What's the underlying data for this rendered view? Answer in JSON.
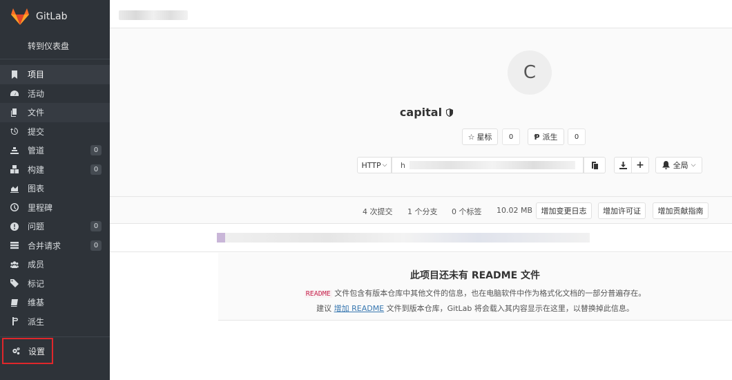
{
  "brand": {
    "name": "GitLab"
  },
  "sidebar": {
    "dashboard_link": "转到仪表盘",
    "items": [
      {
        "label": "项目",
        "icon": "bookmark-icon",
        "count": null
      },
      {
        "label": "活动",
        "icon": "dashboard-icon",
        "count": null
      },
      {
        "label": "文件",
        "icon": "files-icon",
        "count": null
      },
      {
        "label": "提交",
        "icon": "history-icon",
        "count": null
      },
      {
        "label": "管道",
        "icon": "pipeline-icon",
        "count": "0"
      },
      {
        "label": "构建",
        "icon": "cubes-icon",
        "count": "0"
      },
      {
        "label": "图表",
        "icon": "area-chart-icon",
        "count": null
      },
      {
        "label": "里程碑",
        "icon": "clock-icon",
        "count": null
      },
      {
        "label": "问题",
        "icon": "exclamation-circle-icon",
        "count": "0"
      },
      {
        "label": "合并请求",
        "icon": "tasks-icon",
        "count": "0"
      },
      {
        "label": "成员",
        "icon": "users-icon",
        "count": null
      },
      {
        "label": "标记",
        "icon": "tags-icon",
        "count": null
      },
      {
        "label": "维基",
        "icon": "book-icon",
        "count": null
      },
      {
        "label": "派生",
        "icon": "fork-icon",
        "count": null
      }
    ],
    "settings": "设置"
  },
  "project": {
    "avatar_letter": "C",
    "name": "capital",
    "star_label": "星标",
    "star_count": "0",
    "fork_label": "派生",
    "fork_count": "0",
    "protocol": "HTTP",
    "url_prefix": "h",
    "global_label": "全局"
  },
  "stats": {
    "commits": "4 次提交",
    "branches": "1 个分支",
    "tags": "0 个标签",
    "size": "10.02 MB",
    "add_changelog": "增加变更日志",
    "add_license": "增加许可证",
    "add_contributing": "增加贡献指南"
  },
  "readme": {
    "title": "此项目还未有 README 文件",
    "code": "README",
    "line1_rest": " 文件包含有版本仓库中其他文件的信息，也在电脑软件中作为格式化文档的一部分普遍存在。",
    "line2_pre": "建议 ",
    "line2_link": "增加 README",
    "line2_post": " 文件到版本仓库，GitLab 将会载入其内容显示在这里，以替换掉此信息。"
  },
  "colors": {
    "sidebar_bg": "#2e3339",
    "settings_highlight": "#e0272b",
    "link": "#3777b0"
  }
}
